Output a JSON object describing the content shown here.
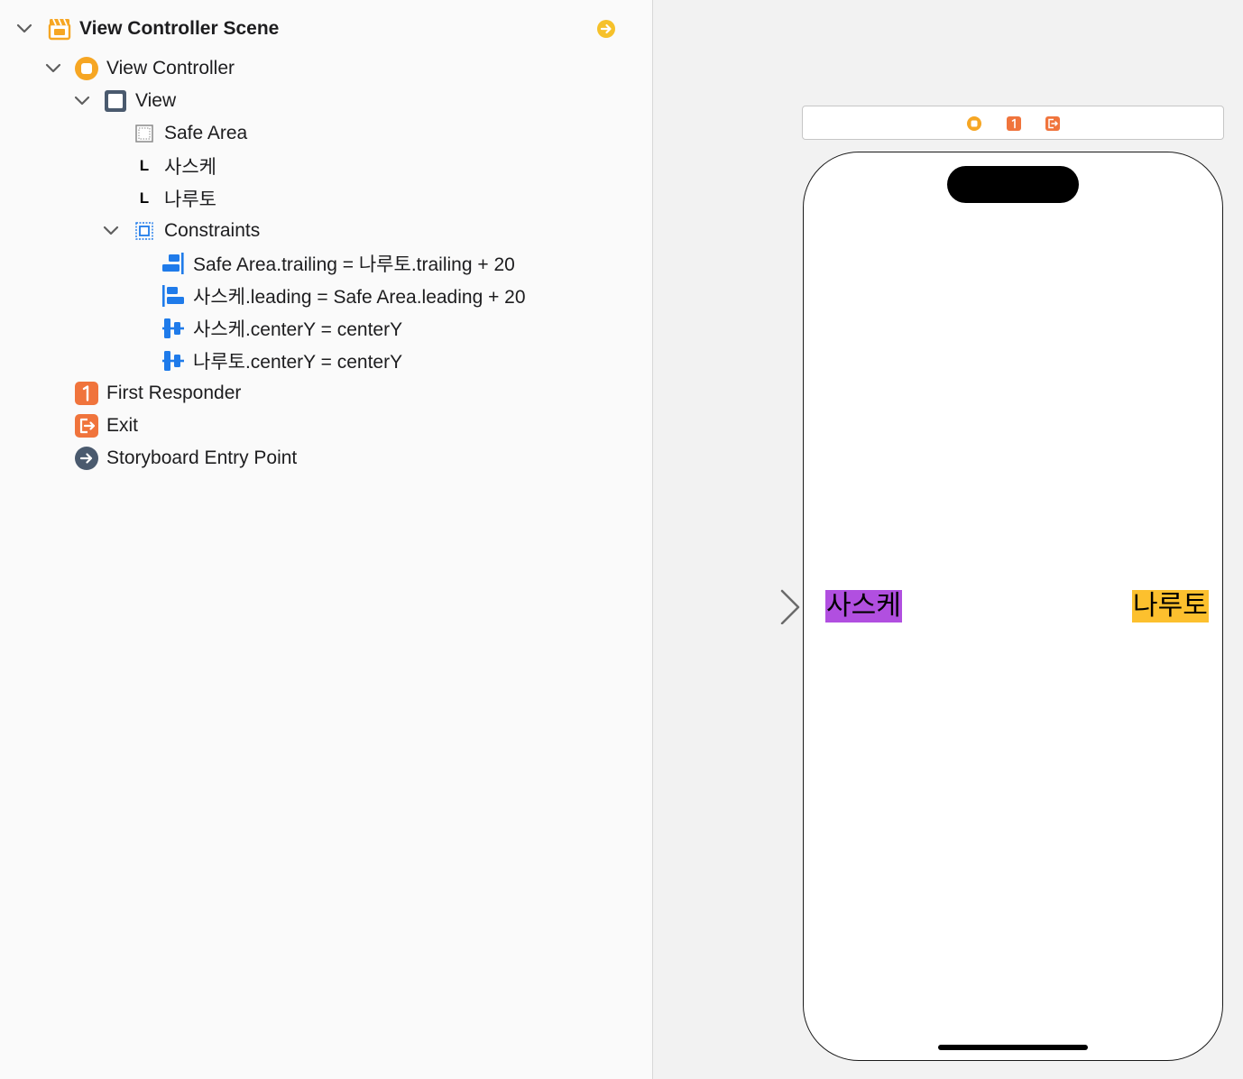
{
  "outline": {
    "scene": {
      "label": "View Controller Scene"
    },
    "view_controller": {
      "label": "View Controller"
    },
    "view": {
      "label": "View"
    },
    "safe_area": {
      "label": "Safe Area"
    },
    "label_1": {
      "label": "사스케"
    },
    "label_2": {
      "label": "나루토"
    },
    "constraints": {
      "label": "Constraints",
      "items": [
        {
          "label": "Safe Area.trailing = 나루토.trailing + 20"
        },
        {
          "label": "사스케.leading = Safe Area.leading + 20"
        },
        {
          "label": "사스케.centerY = centerY"
        },
        {
          "label": "나루토.centerY = centerY"
        }
      ]
    },
    "first_responder": {
      "label": "First Responder"
    },
    "exit": {
      "label": "Exit"
    },
    "entry_point": {
      "label": "Storyboard Entry Point"
    }
  },
  "canvas": {
    "label_left": {
      "text": "사스케",
      "bg": "#b14fe0"
    },
    "label_right": {
      "text": "나루토",
      "bg": "#fcc02e"
    }
  },
  "colors": {
    "vc_orange": "#f6a623",
    "responder_orange": "#f0743c",
    "constraint_blue": "#1f7bea",
    "view_slate": "#4a5a6e"
  },
  "icons": {
    "scene": "storyboard-scene-icon",
    "view_controller": "view-controller-icon",
    "view": "view-icon",
    "safe_area": "safe-area-icon",
    "label": "label-icon",
    "constraints": "constraints-icon",
    "first_responder": "first-responder-icon",
    "exit": "exit-icon",
    "entry_point": "entry-point-icon"
  }
}
